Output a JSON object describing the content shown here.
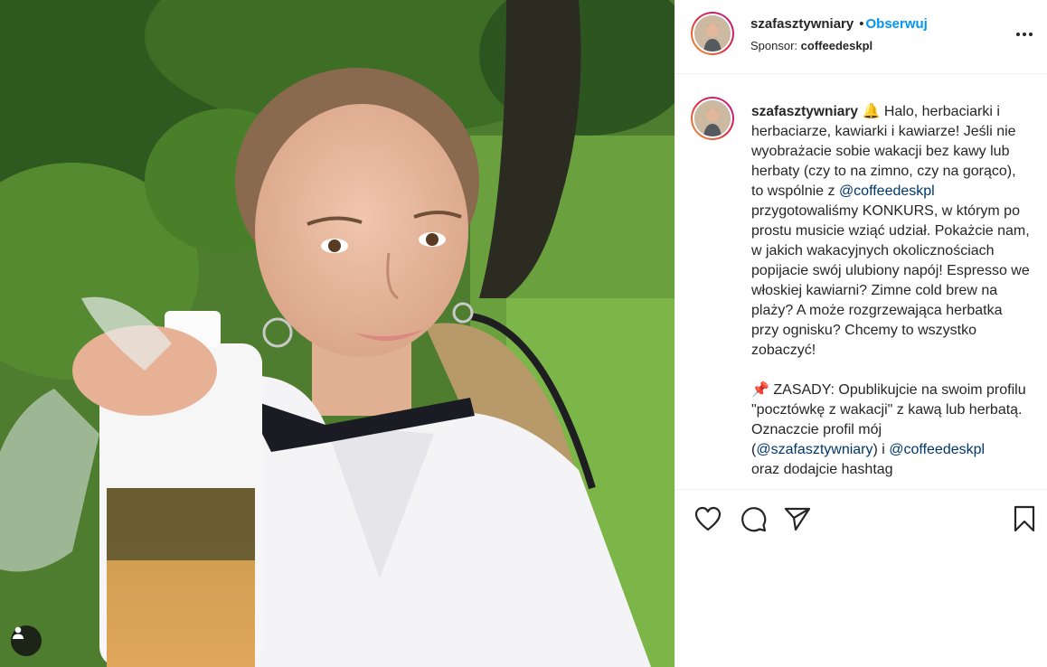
{
  "post": {
    "username": "szafasztywniary",
    "follow_label": "Obserwuj",
    "sponsor_prefix": "Sponsor:",
    "sponsor_name": "coffeedeskpl"
  },
  "caption": {
    "username": "szafasztywniary",
    "p1": " 🔔 Halo, herbaciarki i herbaciarze, kawiarki i kawiarze! Jeśli nie wyobrażacie sobie wakacji bez kawy lub herbaty (czy to na zimno, czy na gorąco), to wspólnie z ",
    "mention1": "@coffeedeskpl",
    "p2": " przygotowaliśmy KONKURS, w którym po prostu musicie wziąć udział. Pokażcie nam, w jakich wakacyjnych okolicznościach popijacie swój ulubiony napój! Espresso we włoskiej kawiarni? Zimne cold brew na plaży? A może rozgrzewająca herbatka przy ognisku? Chcemy to wszystko zobaczyć!\n\n📌 ZASADY: Opublikujcie na swoim profilu \"pocztówkę z wakacji\" z kawą lub herbatą. Oznaczcie profil mój\n(",
    "mention2": "@szafasztywniary",
    "p3": ") i ",
    "mention3": "@coffeedeskpl",
    "p4": "\noraz dodajcie hashtag"
  },
  "icons": {
    "like": "heart-icon",
    "comment": "comment-icon",
    "share": "paper-plane-icon",
    "save": "bookmark-icon",
    "more": "more-options-icon",
    "tag": "user-tag-icon"
  },
  "colors": {
    "follow": "#0095f6",
    "mention": "#00376b",
    "avatar_gradient": [
      "#f09433",
      "#dc2743",
      "#bc1888"
    ]
  }
}
